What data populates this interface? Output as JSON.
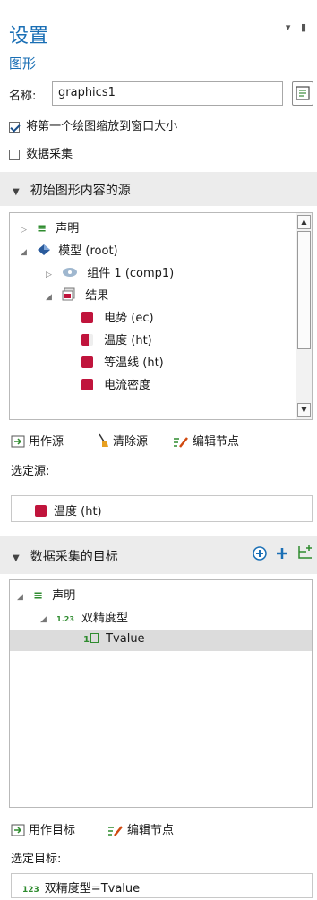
{
  "header": {
    "title": "设置",
    "subtitle": "图形",
    "controls": "▾ ▮"
  },
  "name_field": {
    "label": "名称:",
    "value": "graphics1"
  },
  "options": [
    {
      "label": "将第一个绘图缩放到窗口大小",
      "checked": true
    },
    {
      "label": "数据采集",
      "checked": false
    }
  ],
  "source_section": {
    "title": "初始图形内容的源",
    "tree": [
      {
        "label": "声明",
        "icon": "declarations-icon",
        "expander": "▷"
      },
      {
        "label": "模型 (root)",
        "icon": "model-root-icon",
        "expander": "◢"
      },
      {
        "label": "组件 1 (comp1)",
        "icon": "component-icon",
        "expander": "▷"
      },
      {
        "label": "结果",
        "icon": "results-icon",
        "expander": "◢"
      },
      {
        "label": "电势 (ec)",
        "icon": "plot-group-icon"
      },
      {
        "label": "温度 (ht)",
        "icon": "plot-group-data-icon"
      },
      {
        "label": "等温线 (ht)",
        "icon": "plot-group-icon"
      },
      {
        "label": "电流密度",
        "icon": "plot-group-icon"
      }
    ],
    "toolbar": {
      "use_as_source": "用作源",
      "clear_source": "清除源",
      "edit_node": "编辑节点"
    },
    "selected_label": "选定源:",
    "selected_value": "温度 (ht)"
  },
  "target_section": {
    "title": "数据采集的目标",
    "tree": [
      {
        "label": "声明",
        "icon": "declarations-icon",
        "expander": "◢"
      },
      {
        "label": "双精度型",
        "prefix": "1.23",
        "icon": "double-type-icon",
        "expander": "◢"
      },
      {
        "label": "Tvalue",
        "prefix": "1",
        "icon": "variable-icon",
        "selected": true
      }
    ],
    "toolbar": {
      "use_as_target": "用作目标",
      "edit_node": "编辑节点"
    },
    "selected_label": "选定目标:",
    "selected_value": "双精度型=Tvalue",
    "selected_prefix": "123"
  },
  "colors": {
    "accent": "#1a6fb5",
    "plot_red": "#c0143c",
    "section_bg": "#ececec",
    "selection": "#dcdcdc"
  }
}
